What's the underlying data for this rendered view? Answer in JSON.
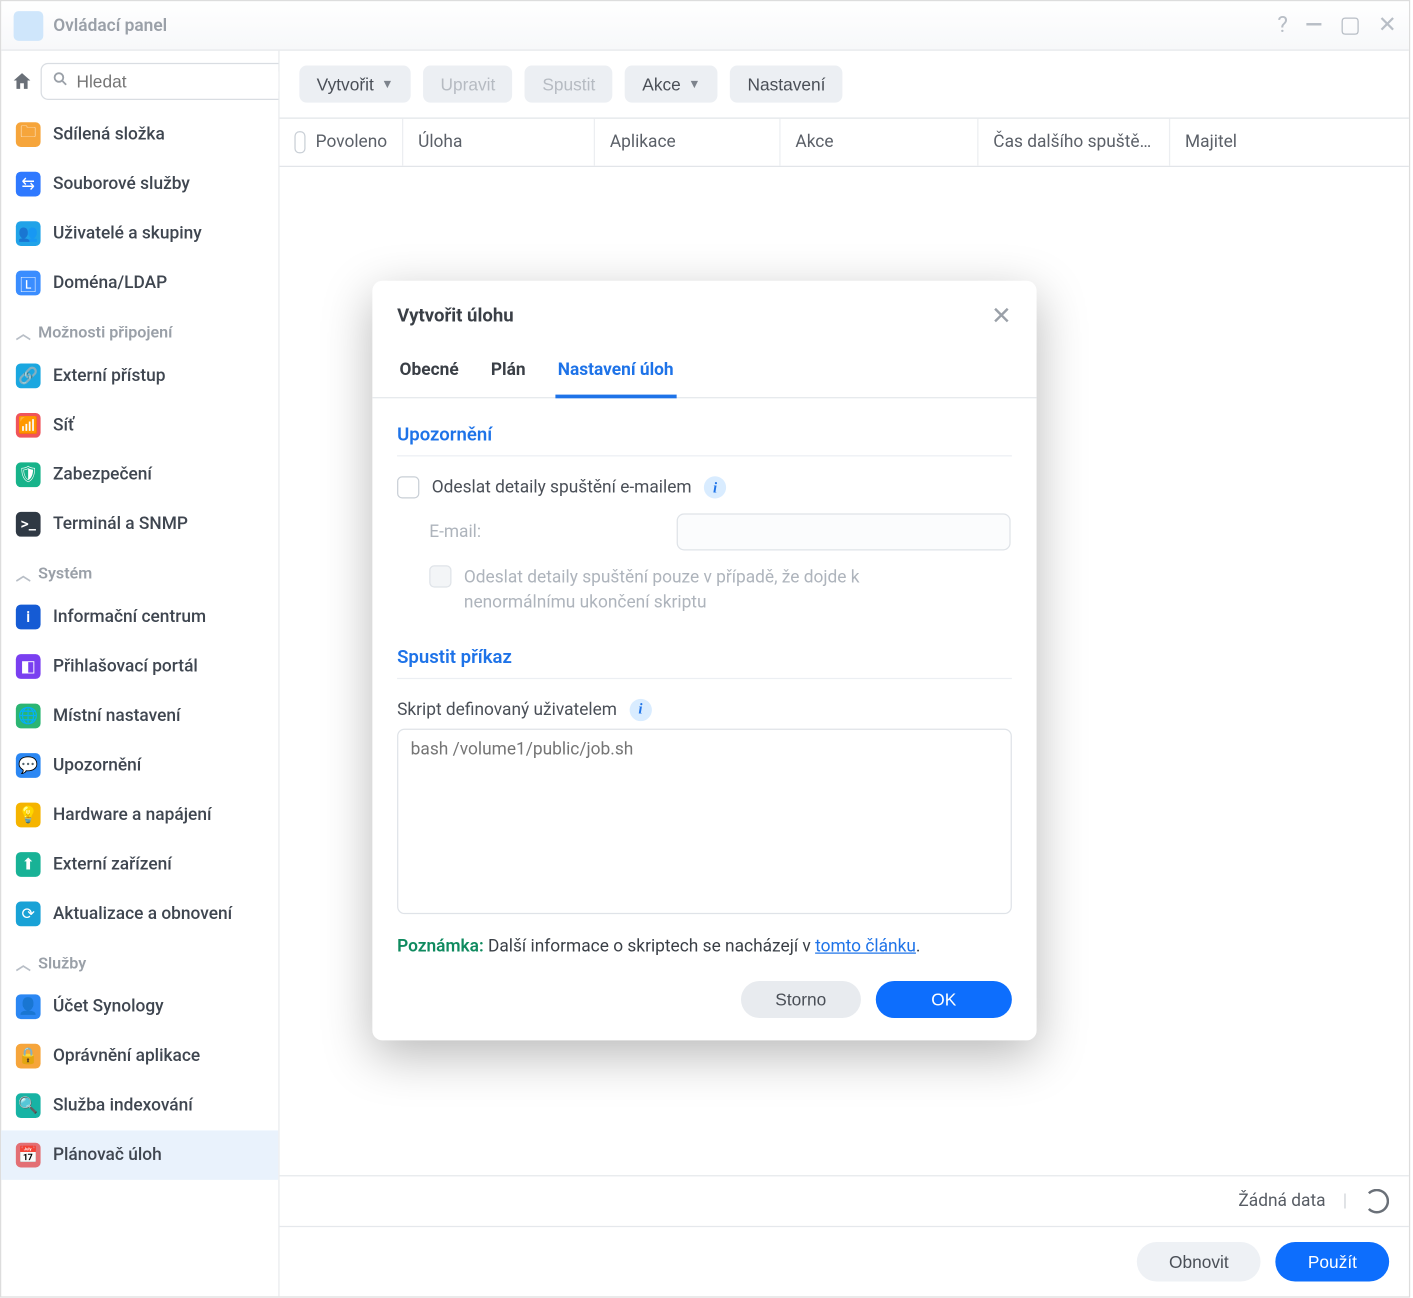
{
  "titlebar": {
    "title": "Ovládací panel"
  },
  "search": {
    "placeholder": "Hledat"
  },
  "sidebar": {
    "items": [
      {
        "label": "Sdílená složka",
        "icon_bg": "#f6a53b"
      },
      {
        "label": "Souborové služby",
        "icon_bg": "#2f79ff"
      },
      {
        "label": "Uživatelé a skupiny",
        "icon_bg": "#21a3e8"
      },
      {
        "label": "Doména/LDAP",
        "icon_bg": "#3a8dff"
      }
    ],
    "section_connect": "Možnosti připojení",
    "items2": [
      {
        "label": "Externí přístup",
        "icon_bg": "#1aa7e0"
      },
      {
        "label": "Síť",
        "icon_bg": "#f0545a"
      },
      {
        "label": "Zabezpečení",
        "icon_bg": "#17b38a"
      },
      {
        "label": "Terminál a SNMP",
        "icon_bg": "#2f3944"
      }
    ],
    "section_system": "Systém",
    "items3": [
      {
        "label": "Informační centrum",
        "icon_bg": "#155bd4"
      },
      {
        "label": "Přihlašovací portál",
        "icon_bg": "#7a3ff0"
      },
      {
        "label": "Místní nastavení",
        "icon_bg": "#2bb573"
      },
      {
        "label": "Upozornění",
        "icon_bg": "#2b87f3"
      },
      {
        "label": "Hardware a napájení",
        "icon_bg": "#f5b400"
      },
      {
        "label": "Externí zařízení",
        "icon_bg": "#18b296"
      },
      {
        "label": "Aktualizace a obnovení",
        "icon_bg": "#19a2d6"
      }
    ],
    "section_services": "Služby",
    "items4": [
      {
        "label": "Účet Synology",
        "icon_bg": "#2b87f3"
      },
      {
        "label": "Oprávnění aplikace",
        "icon_bg": "#f6a53b"
      },
      {
        "label": "Služba indexování",
        "icon_bg": "#17b3a4"
      },
      {
        "label": "Plánovač úloh",
        "icon_bg": "#e36f74",
        "active": true
      }
    ]
  },
  "toolbar": {
    "create": "Vytvořit",
    "edit": "Upravit",
    "run": "Spustit",
    "action": "Akce",
    "settings": "Nastavení"
  },
  "table": {
    "cols": {
      "enabled": "Povoleno",
      "task": "Úloha",
      "app": "Aplikace",
      "action": "Akce",
      "next": "Čas dalšího spuště…",
      "owner": "Majitel"
    },
    "empty": "Žádná data"
  },
  "bottom": {
    "reset": "Obnovit",
    "apply": "Použít"
  },
  "dialog": {
    "title": "Vytvořit úlohu",
    "tabs": {
      "general": "Obecné",
      "plan": "Plán",
      "tasksettings": "Nastavení úloh"
    },
    "section_notify": "Upozornění",
    "send_email_label": "Odeslat detaily spuštění e-mailem",
    "email_label": "E-mail:",
    "abnormal_label": "Odeslat detaily spuštění pouze v případě, že dojde k nenormálnímu ukončení skriptu",
    "section_run": "Spustit příkaz",
    "user_script_label": "Skript definovaný uživatelem",
    "script_placeholder": "bash /volume1/public/job.sh",
    "note_label": "Poznámka:",
    "note_text": " Další informace o skriptech se nacházejí v ",
    "note_link": "tomto článku",
    "note_tail": ".",
    "cancel": "Storno",
    "ok": "OK"
  }
}
